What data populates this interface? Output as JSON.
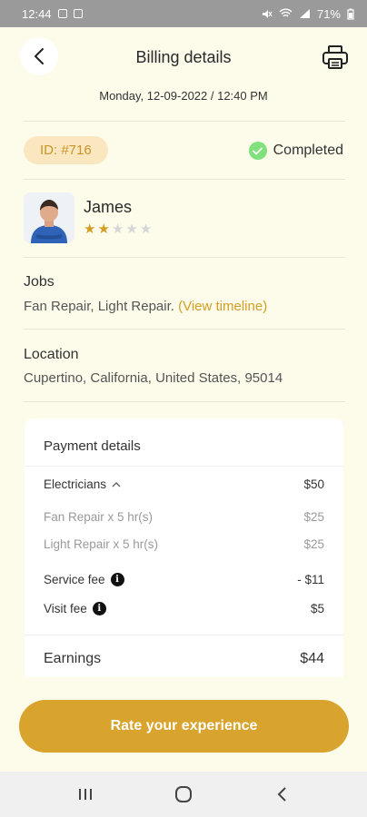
{
  "status_bar": {
    "time": "12:44",
    "battery": "71%"
  },
  "header": {
    "title": "Billing details"
  },
  "datetime": "Monday, 12-09-2022 / 12:40 PM",
  "order": {
    "id": "ID: #716",
    "status": "Completed"
  },
  "user": {
    "name": "James",
    "rating": 2,
    "max_rating": 5,
    "stars": [
      "★",
      "★",
      "★",
      "★",
      "★"
    ]
  },
  "jobs": {
    "label": "Jobs",
    "value": "Fan Repair, Light Repair.",
    "link": "(View timeline)"
  },
  "location": {
    "label": "Location",
    "value": "Cupertino, California, United States, 95014"
  },
  "payment": {
    "title": "Payment details",
    "group_label": "Electricians",
    "group_amount": "$50",
    "items": [
      {
        "label": "Fan Repair x  5 hr(s)",
        "amount": "$25"
      },
      {
        "label": "Light Repair x  5 hr(s)",
        "amount": "$25"
      }
    ],
    "service_fee": {
      "label": "Service fee",
      "amount": "- $11"
    },
    "visit_fee": {
      "label": "Visit fee",
      "amount": "$5"
    },
    "earnings": {
      "label": "Earnings",
      "amount": "$44"
    }
  },
  "cta": {
    "label": "Rate your experience"
  },
  "colors": {
    "accent": "#d9a42e",
    "badge_bg": "#fbe7bf",
    "success": "#7fe07c",
    "background": "#fdfbea"
  },
  "icons": [
    "back-arrow-icon",
    "printer-icon",
    "check-icon",
    "info-icon",
    "chevron-up-icon",
    "recent-apps-icon",
    "home-icon",
    "nav-back-icon"
  ]
}
